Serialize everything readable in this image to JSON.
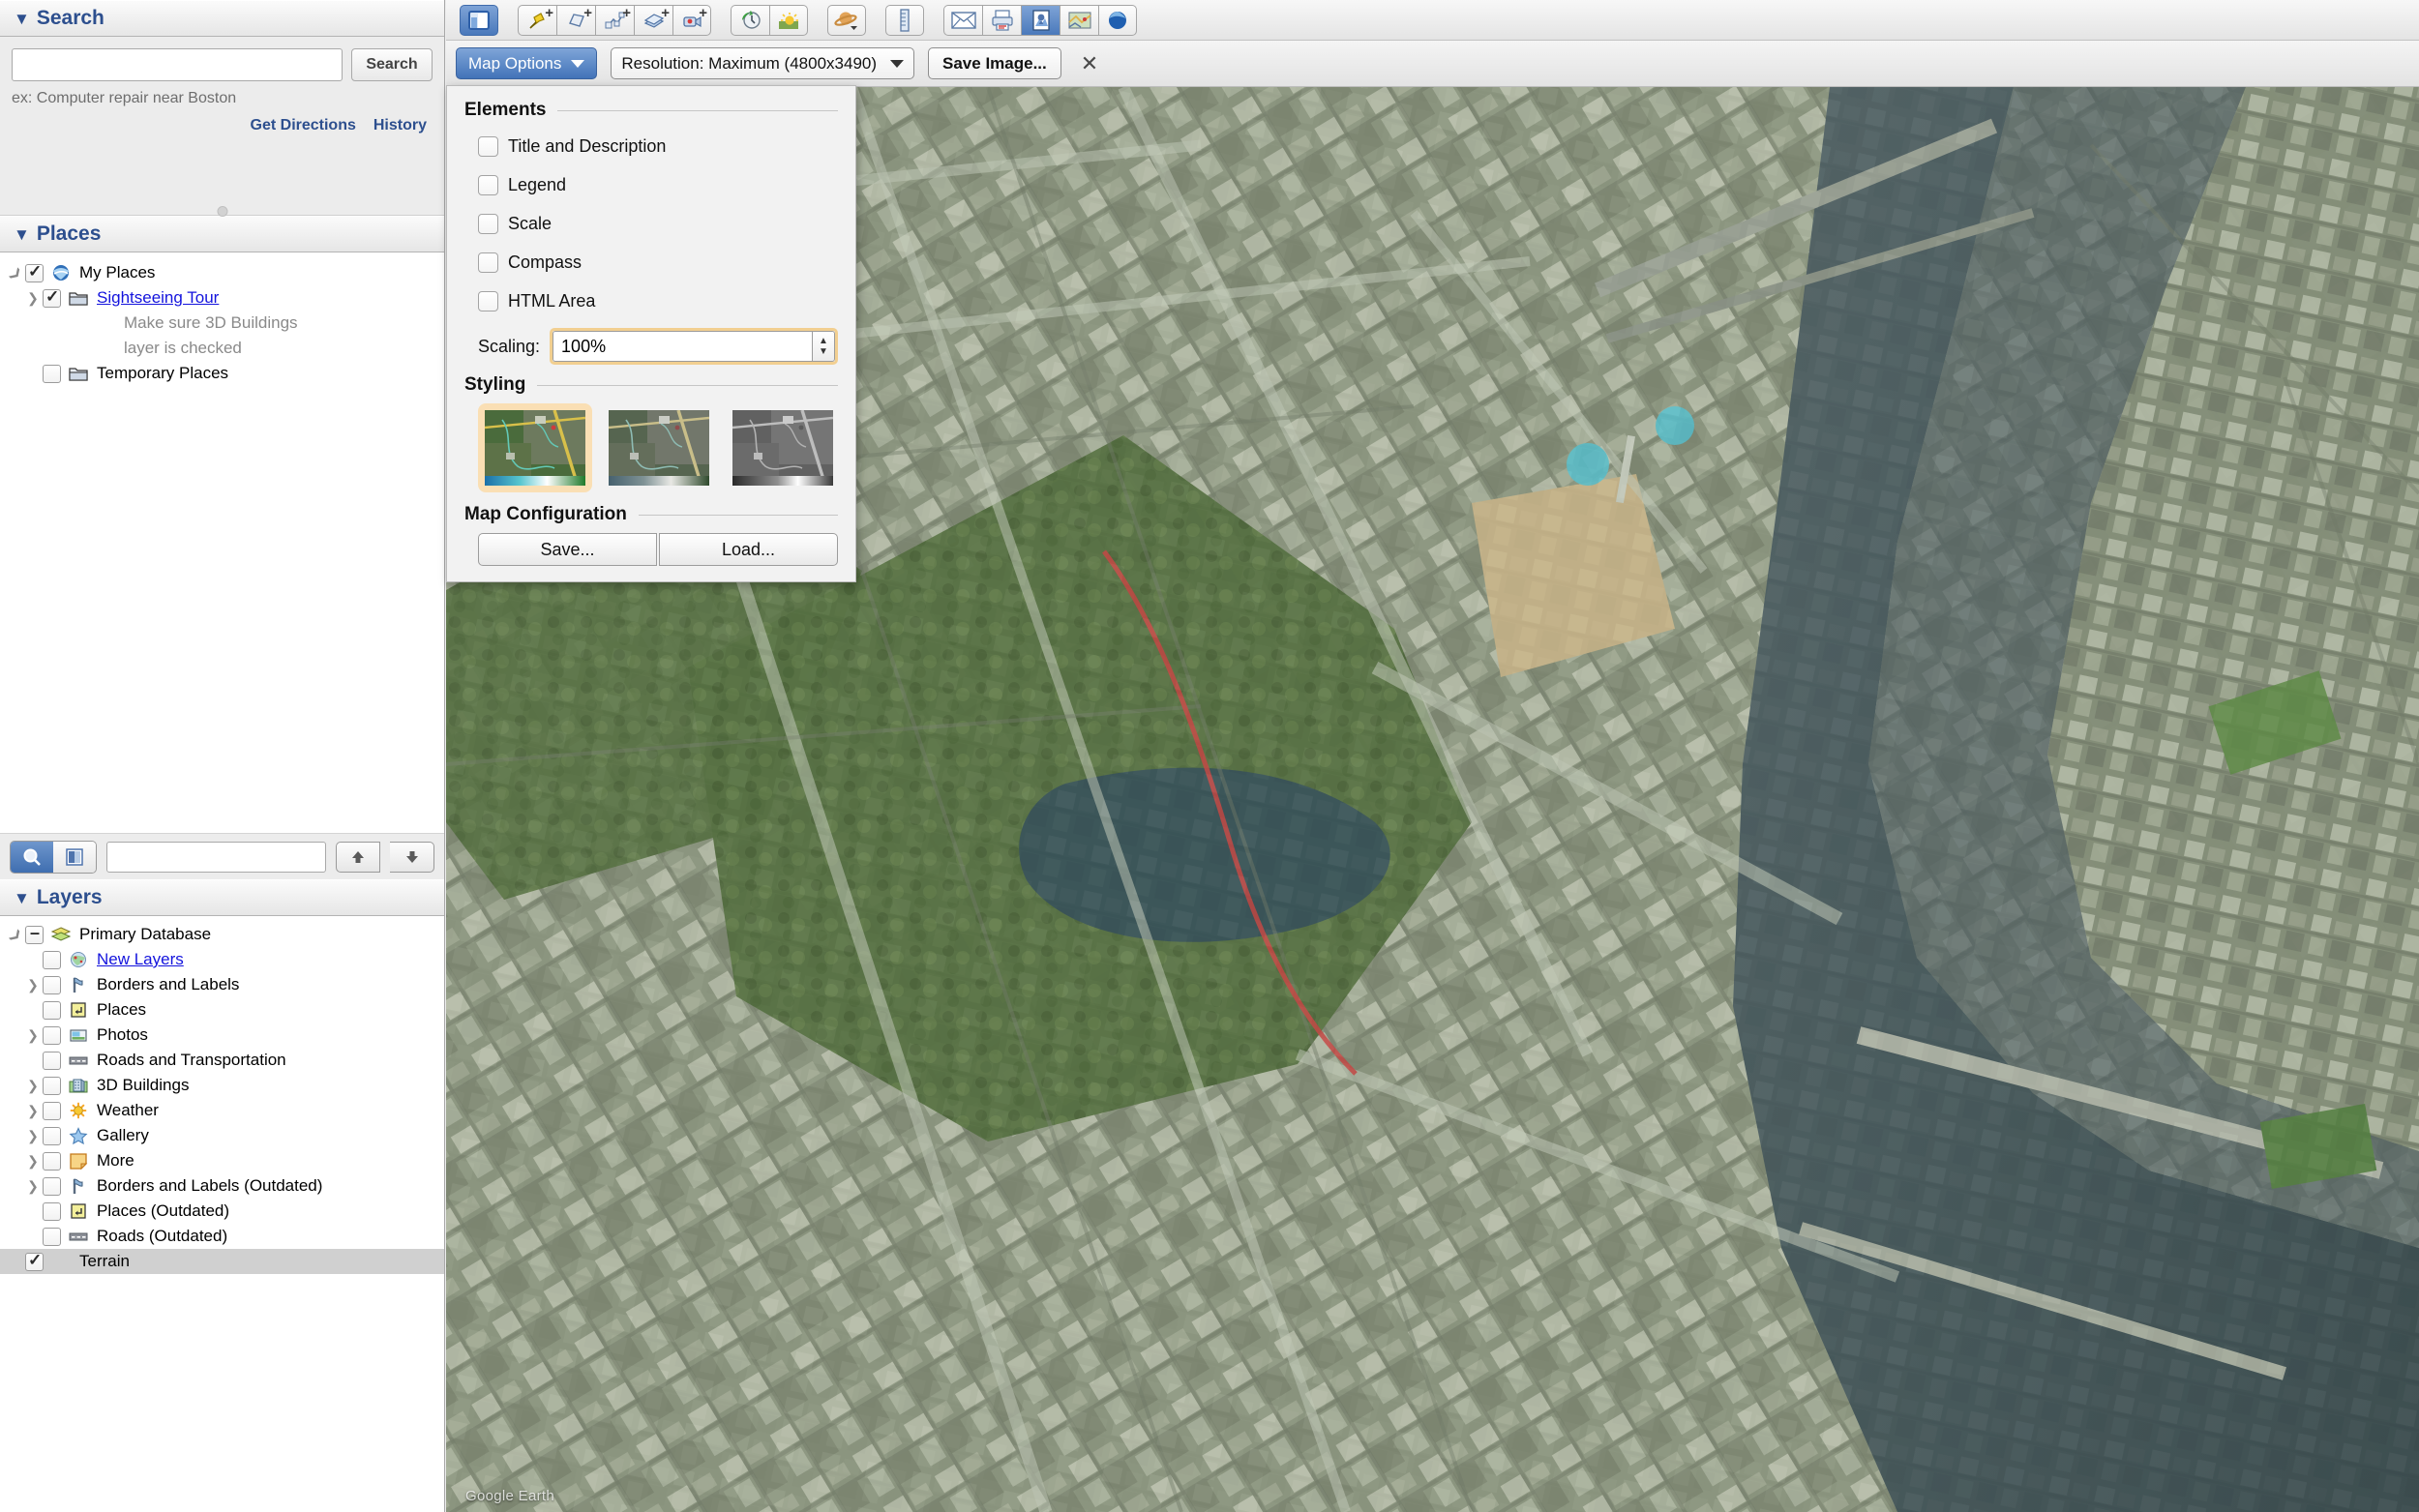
{
  "search": {
    "title": "Search",
    "input_value": "",
    "button_label": "Search",
    "hint": "ex: Computer repair near Boston",
    "get_directions": "Get Directions",
    "history": "History"
  },
  "places": {
    "title": "Places",
    "items": [
      {
        "label": "My Places",
        "icon": "earth-icon",
        "checked": true,
        "disclosure": "open",
        "indent": 0,
        "style": "normal"
      },
      {
        "label": "Sightseeing Tour",
        "icon": "folder-icon",
        "checked": true,
        "disclosure": "closed",
        "indent": 1,
        "style": "link"
      },
      {
        "label": "Make sure 3D Buildings",
        "icon": "none",
        "checked": null,
        "disclosure": "none",
        "indent": 2,
        "style": "sub"
      },
      {
        "label": "layer is checked",
        "icon": "none",
        "checked": null,
        "disclosure": "none",
        "indent": 2,
        "style": "sub"
      },
      {
        "label": "Temporary Places",
        "icon": "folder-icon",
        "checked": false,
        "disclosure": "none",
        "indent": 1,
        "style": "normal"
      }
    ]
  },
  "places_toolbar": {
    "search_mode_label": "search-layers",
    "view_mode_label": "layer-opacity",
    "filter_value": "",
    "move_up_label": "▲",
    "move_down_label": "▼"
  },
  "layers": {
    "title": "Layers",
    "items": [
      {
        "label": "Primary Database",
        "icon": "stack-icon",
        "checked": "dash",
        "disclosure": "open",
        "indent": 0,
        "style": "normal",
        "selected": false
      },
      {
        "label": "New Layers",
        "icon": "newlayers-icon",
        "checked": false,
        "disclosure": "none",
        "indent": 1,
        "style": "link",
        "selected": false
      },
      {
        "label": "Borders and Labels",
        "icon": "borders-icon",
        "checked": false,
        "disclosure": "closed",
        "indent": 1,
        "style": "normal",
        "selected": false
      },
      {
        "label": "Places",
        "icon": "places-icon",
        "checked": false,
        "disclosure": "none",
        "indent": 1,
        "style": "normal",
        "selected": false
      },
      {
        "label": "Photos",
        "icon": "photos-icon",
        "checked": false,
        "disclosure": "closed",
        "indent": 1,
        "style": "normal",
        "selected": false
      },
      {
        "label": "Roads and Transportation",
        "icon": "roads-icon",
        "checked": false,
        "disclosure": "none",
        "indent": 1,
        "style": "normal",
        "selected": false
      },
      {
        "label": "3D Buildings",
        "icon": "buildings-icon",
        "checked": false,
        "disclosure": "closed",
        "indent": 1,
        "style": "normal",
        "selected": false
      },
      {
        "label": "Weather",
        "icon": "weather-icon",
        "checked": false,
        "disclosure": "closed",
        "indent": 1,
        "style": "normal",
        "selected": false
      },
      {
        "label": "Gallery",
        "icon": "gallery-star-icon",
        "checked": false,
        "disclosure": "closed",
        "indent": 1,
        "style": "normal",
        "selected": false
      },
      {
        "label": "More",
        "icon": "more-note-icon",
        "checked": false,
        "disclosure": "closed",
        "indent": 1,
        "style": "normal",
        "selected": false
      },
      {
        "label": "Borders and Labels (Outdated)",
        "icon": "borders-icon",
        "checked": false,
        "disclosure": "closed",
        "indent": 1,
        "style": "normal",
        "selected": false
      },
      {
        "label": "Places (Outdated)",
        "icon": "places-icon",
        "checked": false,
        "disclosure": "none",
        "indent": 1,
        "style": "normal",
        "selected": false
      },
      {
        "label": "Roads (Outdated)",
        "icon": "roads-icon",
        "checked": false,
        "disclosure": "none",
        "indent": 1,
        "style": "normal",
        "selected": false
      },
      {
        "label": "Terrain",
        "icon": "none",
        "checked": true,
        "disclosure": "none",
        "indent": 0,
        "style": "normal",
        "selected": true
      }
    ]
  },
  "toolbar": {
    "buttons": [
      {
        "name": "toggle-sidebar-icon",
        "group": 0,
        "selected": true,
        "plus": false
      },
      {
        "name": "add-placemark-icon",
        "group": 1,
        "selected": false,
        "plus": true
      },
      {
        "name": "add-polygon-icon",
        "group": 1,
        "selected": false,
        "plus": true
      },
      {
        "name": "add-path-icon",
        "group": 1,
        "selected": false,
        "plus": true
      },
      {
        "name": "add-image-overlay-icon",
        "group": 1,
        "selected": false,
        "plus": true
      },
      {
        "name": "record-tour-icon",
        "group": 1,
        "selected": false,
        "plus": true
      },
      {
        "name": "historical-imagery-icon",
        "group": 2,
        "selected": false,
        "plus": false
      },
      {
        "name": "sunlight-icon",
        "group": 2,
        "selected": false,
        "plus": false
      },
      {
        "name": "planets-icon",
        "group": 3,
        "selected": false,
        "plus": false
      },
      {
        "name": "ruler-icon",
        "group": 4,
        "selected": false,
        "plus": false
      },
      {
        "name": "email-icon",
        "group": 5,
        "selected": false,
        "plus": false
      },
      {
        "name": "print-icon",
        "group": 5,
        "selected": false,
        "plus": false
      },
      {
        "name": "save-image-icon",
        "group": 5,
        "selected": true,
        "plus": false
      },
      {
        "name": "view-in-google-maps-icon",
        "group": 5,
        "selected": false,
        "plus": false
      },
      {
        "name": "earth-globe-icon",
        "group": 5,
        "selected": false,
        "plus": false
      }
    ]
  },
  "save_image_bar": {
    "map_options_label": "Map Options",
    "resolution_label": "Resolution: Maximum (4800x3490)",
    "save_image_label": "Save Image...",
    "close_label": "✕"
  },
  "map_options": {
    "elements_title": "Elements",
    "elements": [
      {
        "label": "Title and Description",
        "checked": false
      },
      {
        "label": "Legend",
        "checked": false
      },
      {
        "label": "Scale",
        "checked": false
      },
      {
        "label": "Compass",
        "checked": false
      },
      {
        "label": "HTML Area",
        "checked": false
      }
    ],
    "scaling_label": "Scaling:",
    "scaling_value": "100%",
    "styling_title": "Styling",
    "styles": [
      {
        "name": "color-style",
        "selected": true
      },
      {
        "name": "muted-style",
        "selected": false
      },
      {
        "name": "grayscale-style",
        "selected": false
      }
    ],
    "map_config_title": "Map Configuration",
    "save_label": "Save...",
    "load_label": "Load..."
  },
  "map": {
    "attribution": "Google Earth"
  },
  "colors": {
    "accent_blue": "#2d4f8e",
    "button_blue": "#4273b8",
    "focus_ring": "#f2cf90",
    "link_blue": "#1414dd"
  }
}
